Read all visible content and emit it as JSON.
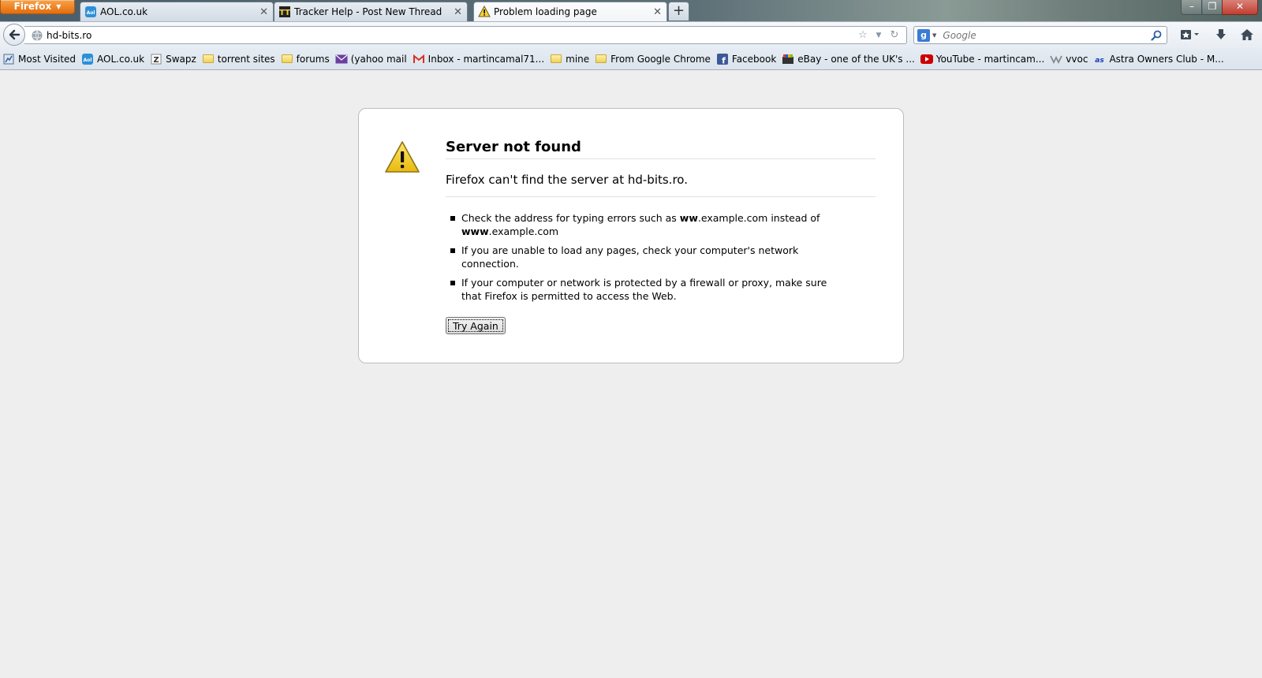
{
  "browser": {
    "menu_button": "Firefox",
    "tabs": [
      {
        "label": "AOL.co.uk",
        "icon": "aol-icon",
        "active": false
      },
      {
        "label": "Tracker Help - Post New Thread",
        "icon": "tracker-icon",
        "active": false
      },
      {
        "label": "Problem loading page",
        "icon": "warning-icon",
        "active": true
      }
    ],
    "new_tab": "+",
    "address": "hd-bits.ro",
    "search_placeholder": "Google",
    "search_engine_letter": "g"
  },
  "bookmarks": [
    {
      "label": "Most Visited",
      "icon": "most-visited-icon"
    },
    {
      "label": "AOL.co.uk",
      "icon": "aol-icon"
    },
    {
      "label": "Swapz",
      "icon": "swapz-icon"
    },
    {
      "label": "torrent sites",
      "icon": "folder-icon"
    },
    {
      "label": "forums",
      "icon": "folder-icon"
    },
    {
      "label": "(yahoo mail",
      "icon": "yahoo-mail-icon"
    },
    {
      "label": "Inbox - martincamal71...",
      "icon": "gmail-icon"
    },
    {
      "label": "mine",
      "icon": "folder-icon"
    },
    {
      "label": "From Google Chrome",
      "icon": "folder-icon"
    },
    {
      "label": "Facebook",
      "icon": "facebook-icon"
    },
    {
      "label": "eBay - one of the UK's ...",
      "icon": "ebay-icon"
    },
    {
      "label": "YouTube - martincam...",
      "icon": "youtube-icon"
    },
    {
      "label": "vvoc",
      "icon": "vvoc-icon"
    },
    {
      "label": "Astra Owners Club - M...",
      "icon": "astra-icon"
    }
  ],
  "error": {
    "title": "Server not found",
    "description": "Firefox can't find the server at hd-bits.ro.",
    "item1_a": "Check the address for typing errors such as ",
    "item1_b": "ww",
    "item1_c": ".example.com instead of ",
    "item1_d": "www",
    "item1_e": ".example.com",
    "item2": "If you are unable to load any pages, check your computer's network connection.",
    "item3": "If your computer or network is protected by a firewall or proxy, make sure that Firefox is permitted to access the Web.",
    "button": "Try Again"
  }
}
